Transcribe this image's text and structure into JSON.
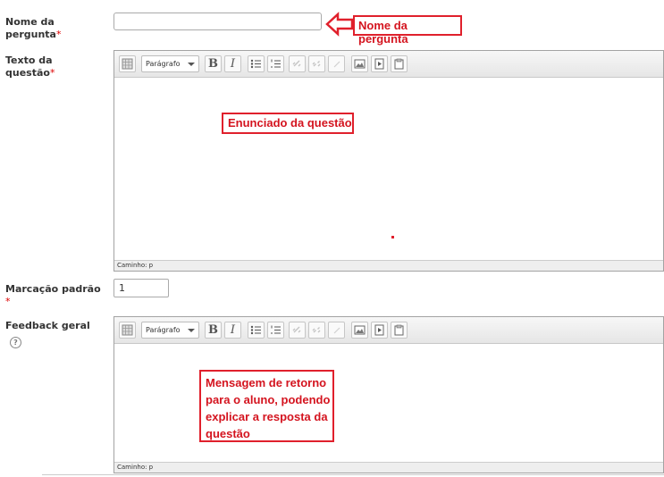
{
  "fields": {
    "question_name": {
      "label": "Nome da pergunta",
      "required_mark": "*",
      "value": ""
    },
    "question_text": {
      "label": "Texto da questão",
      "required_mark": "*"
    },
    "default_mark": {
      "label": "Marcação padrão",
      "required_mark": "*",
      "value": "1"
    },
    "general_feedback": {
      "label": "Feedback geral",
      "help_icon": "?"
    }
  },
  "editor": {
    "format_select": "Parágrafo",
    "bold_label": "B",
    "italic_label": "I",
    "path_label": "Caminho: p",
    "toolbar_icons": [
      "table-icon",
      "bold-icon",
      "italic-icon",
      "bullet-list-icon",
      "numbered-list-icon",
      "link-icon",
      "unlink-icon",
      "anchor-icon",
      "image-icon",
      "media-icon",
      "paste-icon"
    ]
  },
  "annotations": {
    "name": "Nome da pergunta",
    "statement": "Enunciado da questão",
    "feedback_lines": [
      "Mensagem de retorno",
      "para o aluno, podendo",
      "explicar a resposta da",
      "questão"
    ]
  },
  "colors": {
    "annotation": "#e0202c"
  }
}
